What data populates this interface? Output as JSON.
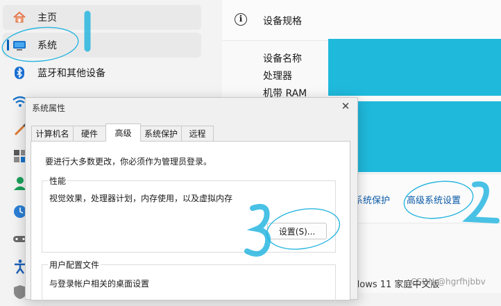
{
  "settings_nav": {
    "items": [
      {
        "label": "主页",
        "icon": "home-icon"
      },
      {
        "label": "系统",
        "icon": "system-display-icon",
        "selected": true
      },
      {
        "label": "蓝牙和其他设备",
        "icon": "bluetooth-icon"
      }
    ]
  },
  "device_spec": {
    "title": "设备规格",
    "labels": [
      "设备名称",
      "处理器",
      "机带 RAM"
    ]
  },
  "related_links": {
    "system_protection": "系统保护",
    "advanced_settings": "高级系统设置"
  },
  "os_edition_partial": "dows 11 家庭中文版",
  "dialog": {
    "title": "系统属性",
    "tabs": [
      {
        "label": "计算机名"
      },
      {
        "label": "硬件"
      },
      {
        "label": "高级",
        "active": true
      },
      {
        "label": "系统保护"
      },
      {
        "label": "远程"
      }
    ],
    "admin_note": "要进行大多数更改，你必须作为管理员登录。",
    "performance": {
      "title": "性能",
      "description": "视觉效果，处理器计划，内存使用，以及虚拟内存",
      "button": "设置(S)..."
    },
    "user_profiles": {
      "title": "用户配置文件",
      "description": "与登录帐户相关的桌面设置"
    }
  },
  "annotations": {
    "step1": "1",
    "step2": "2",
    "step3": "3",
    "color": "#29b6e0"
  },
  "watermark": "CSDN @hgrfhjbbv",
  "colors": {
    "accent": "#005fb8",
    "redaction": "#1fb9dc",
    "link": "#0b5aa6"
  }
}
